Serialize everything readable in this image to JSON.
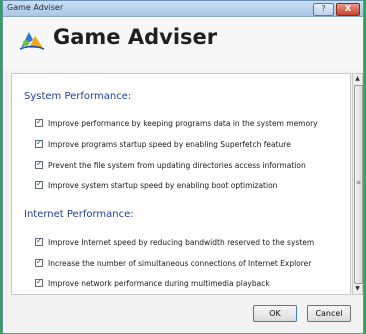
{
  "window": {
    "title": "Game Adviser"
  },
  "title_buttons": {
    "help": "?",
    "close": "X"
  },
  "header": {
    "title": "Game Adviser"
  },
  "sections": [
    {
      "title": "System Performance:",
      "options": [
        {
          "label": "Improve performance by keeping programs data in the system memory",
          "checked": true
        },
        {
          "label": "Improve programs startup speed by enabling Superfetch feature",
          "checked": true
        },
        {
          "label": "Prevent the file system from updating directories access information",
          "checked": true
        },
        {
          "label": "Improve system startup speed by enabling boot optimization",
          "checked": true
        }
      ]
    },
    {
      "title": "Internet Performance:",
      "options": [
        {
          "label": "Improve Internet speed by reducing bandwidth reserved to the system",
          "checked": true
        },
        {
          "label": "Increase the number of simultaneous connections of Internet Explorer",
          "checked": true
        },
        {
          "label": "Improve network performance during multimedia playback",
          "checked": true
        }
      ]
    }
  ],
  "buttons": {
    "ok": "OK",
    "cancel": "Cancel"
  },
  "colors": {
    "section_heading": "#1c3f95",
    "frame_accent": "#2fa35a"
  }
}
